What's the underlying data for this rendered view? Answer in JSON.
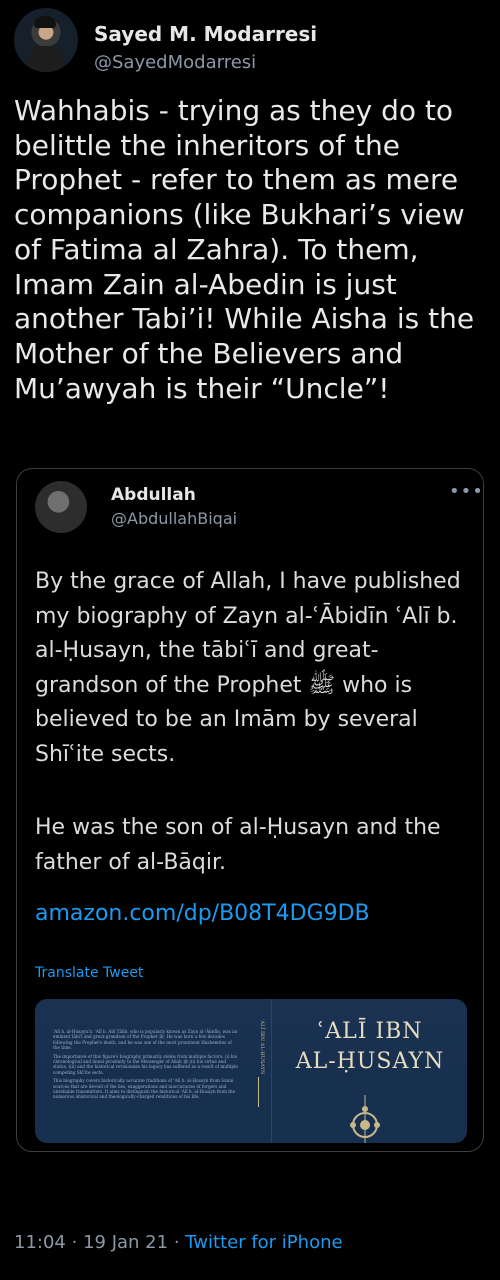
{
  "tweet": {
    "author_name": "Sayed M. Modarresi",
    "author_handle": "@SayedModarresi",
    "text": "Wahhabis - trying as they do to belittle the inheritors of the Prophet - refer to them as mere companions (like Bukhari’s view of Fatima al Zahra). To them, Imam Zain al-Abedin is just another Tabi’i! While Aisha is the Mother of the Believers and Mu’awyah is their “Uncle”!",
    "time": "11:04",
    "date": "19 Jan 21",
    "source": "Twitter for iPhone",
    "separator": "·"
  },
  "quoted": {
    "author_name": "Abdullah",
    "author_handle": "@AbdullahBiqai",
    "more_label": "•••",
    "paragraph1": "By the grace of Allah, I have published my biography of Zayn al-ʿĀbidīn ʿAlī b. al-Ḥusayn, the tābiʿī and great-grandson of the Prophet ﷺ who is believed to be an Imām by several Shīʿite sects.",
    "paragraph2": "He was the son of al-Ḥusayn and the father of al-Bāqir.",
    "link": "amazon.com/dp/B08T4DG9DB",
    "translate_label": "Translate Tweet"
  },
  "book_cover": {
    "title_line1": "ʿALĪ IBN",
    "title_line2": "AL-ḤUSAYN",
    "spine_text": "ʿALĪ IBN AL-ḤUSAYN",
    "blurb_p1": "ʿAlī b. al-Ḥusayn b. ʿAlī b. Abī Ṭālib, who is popularly known as Zayn al-ʿĀbidīn, was an eminent tābiʿī and great-grandson of the Prophet ﷺ. He was born a few decades following the Prophet's death, and he was one of the most prominent Hashemites of the time.",
    "blurb_p2": "The importance of this figure's biography primarily stems from multiple factors: (i) his chronological and lineal proximity to the Messenger of Allah ﷺ (ii) his virtue and status, (iii) and the historical revisionism his legacy has suffered as a result of multiple competing Shīʿite sects.",
    "blurb_p3": "This biography covers historically accurate traditions of ʿAlī b. al-Ḥusayn from Sunni sources that are devoid of the lies, exaggerations and inaccuracies of forgers and unreliable transmitters. It aims to distinguish the historical ʿAlī b. al-Ḥusayn from the numerous ahistorical and theologically-charged renditions of his life.",
    "colors": {
      "background": "#1a3152",
      "title": "#e6dcc0"
    }
  }
}
